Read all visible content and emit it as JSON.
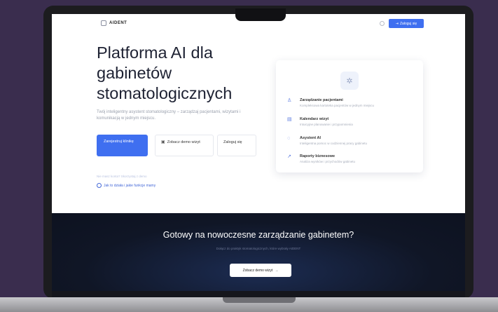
{
  "brand": {
    "name": "AIDENT"
  },
  "nav": {
    "cta_label": "Zaloguj się",
    "cta_icon": "login-icon",
    "theme_icon": "sun-icon"
  },
  "hero": {
    "title_line1": "Platforma AI dla",
    "title_line2": "gabinetów",
    "title_line3": "stomatologicznych",
    "subtitle": "Twój inteligentny asystent stomatologiczny – zarządzaj pacjentami, wizytami i komunikacją w jednym miejscu.",
    "primary_label": "Zarejestruj klinikę",
    "demo_label": "Zobacz demo wizyt",
    "login_label": "Zaloguj się",
    "note": "Nie masz konta? Skorzystaj z demo",
    "help_label": "Jak to działa i jakie funkcje mamy"
  },
  "features": [
    {
      "icon": "users-icon",
      "title": "Zarządzanie pacjentami",
      "desc": "Kompleksowa kartoteka pacjentów w jednym miejscu"
    },
    {
      "icon": "calendar-icon",
      "title": "Kalendarz wizyt",
      "desc": "Intuicyjne planowanie i przypomnienia"
    },
    {
      "icon": "chat-icon",
      "title": "Asystent AI",
      "desc": "Inteligentna pomoc w codziennej pracy gabinetu"
    },
    {
      "icon": "chart-icon",
      "title": "Raporty biznesowe",
      "desc": "Analiza wyników i przychodów gabinetu"
    }
  ],
  "cta": {
    "title": "Gotowy na nowoczesne zarządzanie gabinetem?",
    "subtitle": "Dołącz do praktyk stomatologicznych, które wybrały AIDENT",
    "button_label": "Zobacz demo wizyt",
    "button_arrow": "→"
  },
  "colors": {
    "accent": "#3f6ff0",
    "background": "#3a2d4e",
    "dark_section": "#101626"
  }
}
